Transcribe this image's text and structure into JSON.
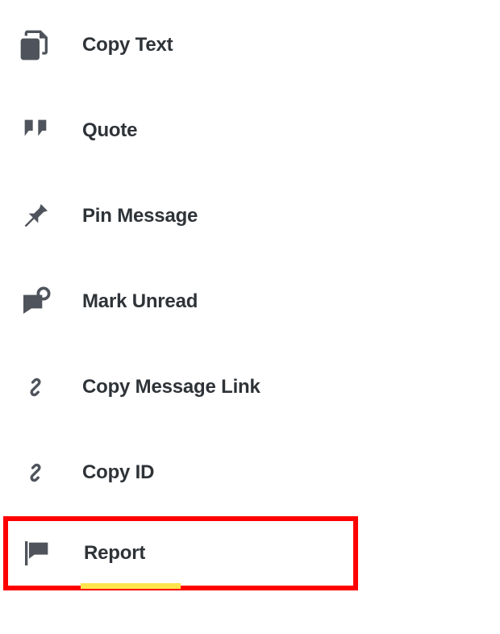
{
  "menu": {
    "copyText": {
      "label": "Copy Text"
    },
    "quote": {
      "label": "Quote"
    },
    "pinMessage": {
      "label": "Pin Message"
    },
    "markUnread": {
      "label": "Mark Unread"
    },
    "copyMessageLink": {
      "label": "Copy Message Link"
    },
    "copyId": {
      "label": "Copy ID"
    },
    "report": {
      "label": "Report"
    }
  },
  "colors": {
    "icon": "#4f545c",
    "text": "#2e3338",
    "highlight": "#ff0000",
    "underline": "#ffe44d"
  }
}
